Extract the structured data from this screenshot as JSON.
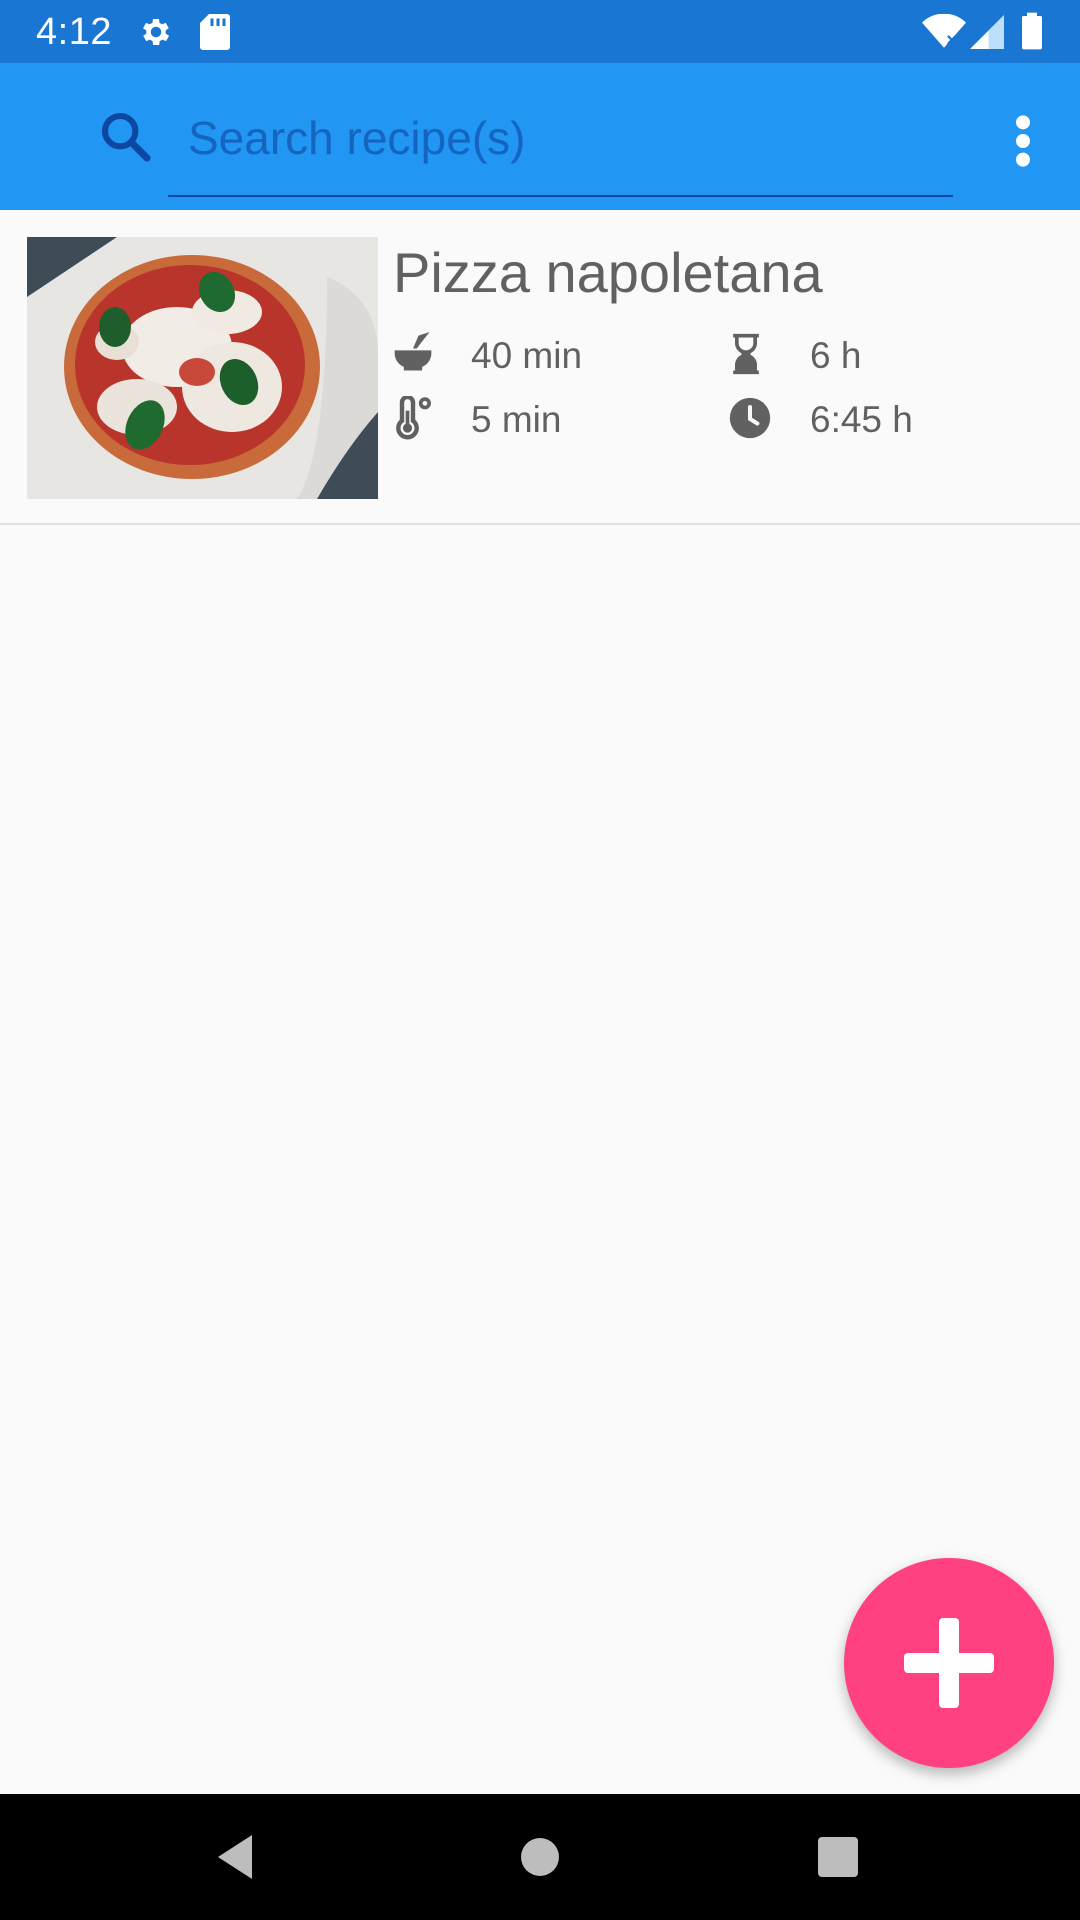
{
  "status_bar": {
    "time": "4:12",
    "icons": [
      "gear-icon",
      "sd-card-icon",
      "wifi-icon",
      "signal-icon",
      "battery-icon"
    ]
  },
  "app_bar": {
    "search_placeholder": "Search recipe(s)",
    "search_value": ""
  },
  "recipes": [
    {
      "title": "Pizza napoletana",
      "prep_time": "40 min",
      "rest_time": "6 h",
      "cook_time": "5 min",
      "total_time": "6:45 h"
    }
  ],
  "fab": {
    "icon": "plus-icon"
  },
  "colors": {
    "status_bar": "#1976d2",
    "app_bar": "#2196f3",
    "accent": "#ff4081",
    "search_text": "#1565c0"
  }
}
